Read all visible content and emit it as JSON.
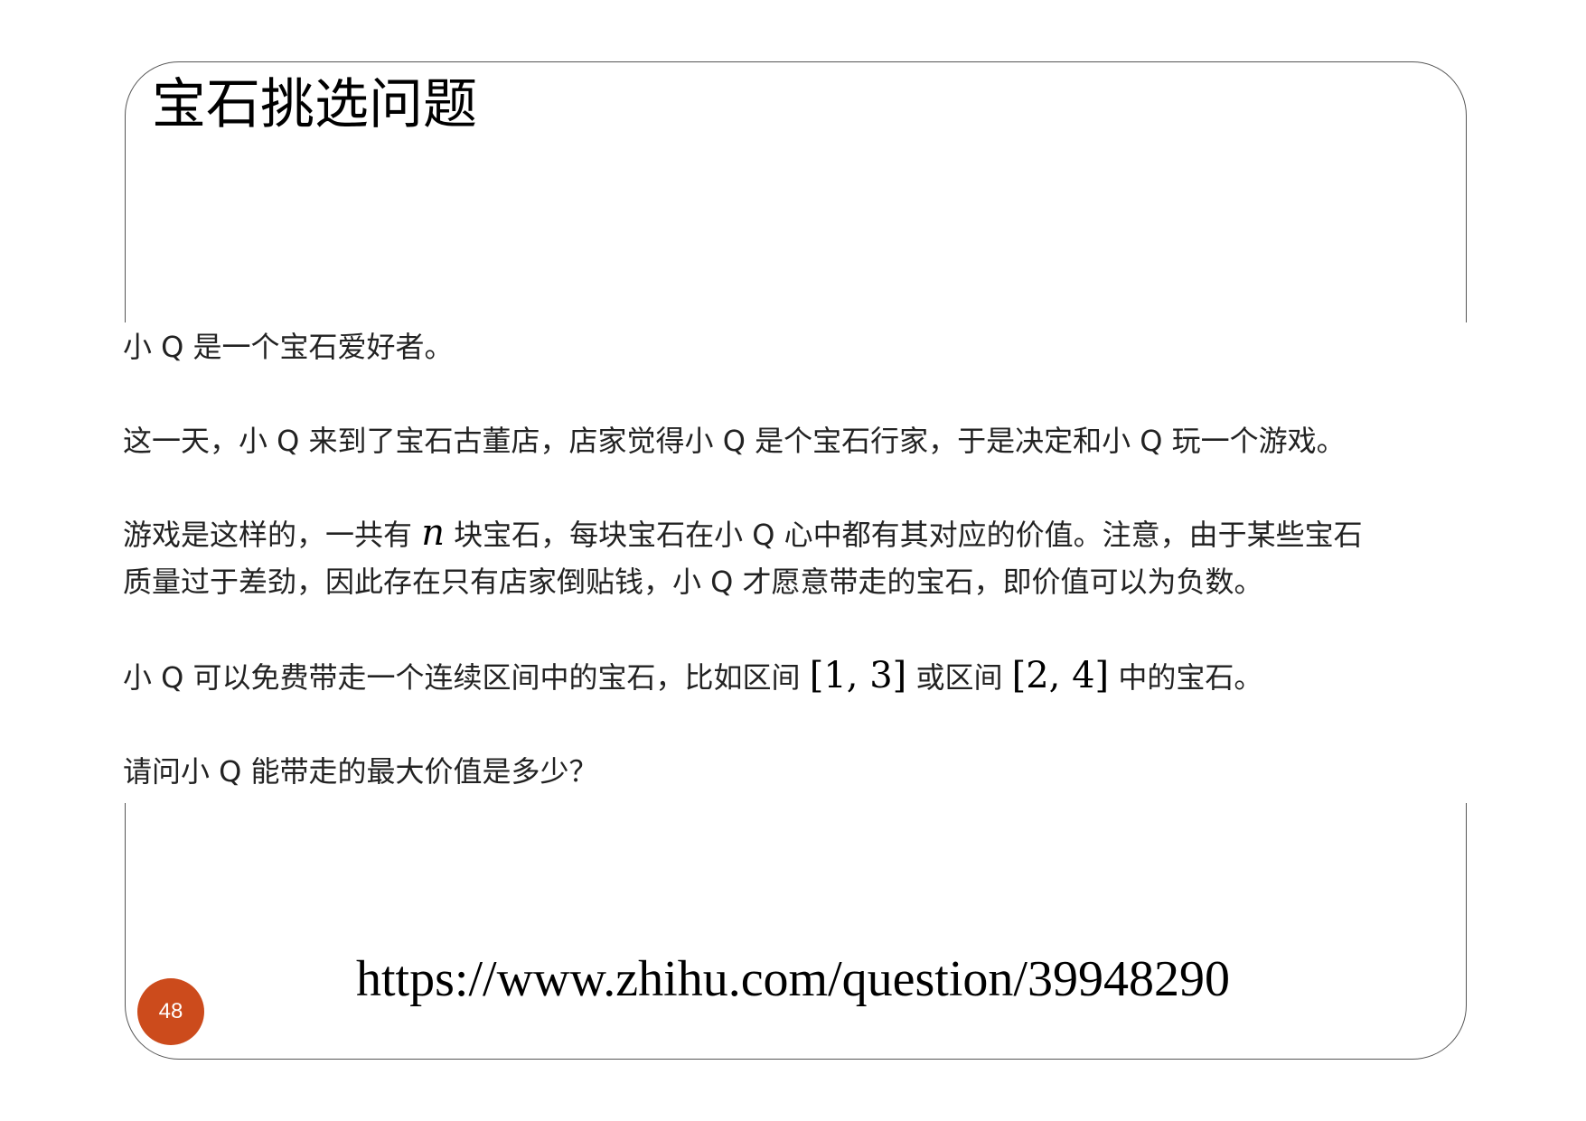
{
  "slide": {
    "title": "宝石挑选问题",
    "page_number": "48",
    "source_url": "https://www.zhihu.com/question/39948290",
    "accent_color": "#cc4b1c"
  },
  "problem": {
    "p1": "小 Q 是一个宝石爱好者。",
    "p2": "这一天，小 Q 来到了宝石古董店，店家觉得小 Q 是个宝石行家，于是决定和小 Q 玩一个游戏。",
    "p3_before": "游戏是这样的，一共有 ",
    "p3_var": "n",
    "p3_after": " 块宝石，每块宝石在小 Q 心中都有其对应的价值。注意，由于某些宝石",
    "p3_line2": "质量过于差劲，因此存在只有店家倒贴钱，小 Q 才愿意带走的宝石，即价值可以为负数。",
    "p4_before": "小 Q 可以免费带走一个连续区间中的宝石，比如区间 ",
    "p4_interval1": "[1, 3]",
    "p4_middle": " 或区间 ",
    "p4_interval2": "[2, 4]",
    "p4_after": " 中的宝石。",
    "p5": "请问小 Q 能带走的最大价值是多少？"
  }
}
